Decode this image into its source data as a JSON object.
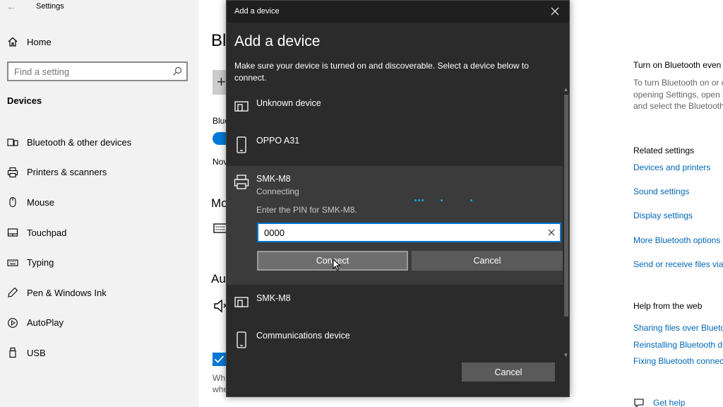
{
  "settings": {
    "app_title": "Settings",
    "home_label": "Home",
    "search_placeholder": "Find a setting",
    "section_title": "Devices",
    "nav": [
      {
        "label": "Bluetooth & other devices",
        "icon": "bluetooth-devices-icon"
      },
      {
        "label": "Printers & scanners",
        "icon": "printer-icon"
      },
      {
        "label": "Mouse",
        "icon": "mouse-icon"
      },
      {
        "label": "Touchpad",
        "icon": "touchpad-icon"
      },
      {
        "label": "Typing",
        "icon": "keyboard-icon"
      },
      {
        "label": "Pen & Windows Ink",
        "icon": "pen-icon"
      },
      {
        "label": "AutoPlay",
        "icon": "autoplay-icon"
      },
      {
        "label": "USB",
        "icon": "usb-icon"
      }
    ]
  },
  "page": {
    "heading_partial": "Bl",
    "bluetooth_label_partial": "Blue",
    "now_label_partial": "Nov",
    "mouse_section_partial": "Mo",
    "audio_section_partial": "Au",
    "wh_line1": "Wh",
    "wh_line2": "whe"
  },
  "right_pane": {
    "title": "Turn on Bluetooth even faster",
    "desc_lines": [
      "To turn Bluetooth on or off without",
      "opening Settings, open action center",
      "and select the Bluetooth icon."
    ],
    "related_title": "Related settings",
    "related_links": [
      "Devices and printers",
      "Sound settings",
      "Display settings",
      "More Bluetooth options",
      "Send or receive files via Bluetooth"
    ],
    "help_title": "Help from the web",
    "help_links": [
      "Sharing files over Bluetooth",
      "Reinstalling Bluetooth drivers",
      "Fixing Bluetooth connections"
    ],
    "get_help": "Get help"
  },
  "dialog": {
    "window_title": "Add a device",
    "heading": "Add a device",
    "description": "Make sure your device is turned on and discoverable. Select a device below to connect.",
    "devices": [
      {
        "name": "Unknown device",
        "icon": "display-device-icon"
      },
      {
        "name": "OPPO A31",
        "icon": "phone-icon"
      },
      {
        "name": "SMK-M8",
        "icon": "printer-icon",
        "status": "Connecting",
        "pin_prompt": "Enter the PIN for SMK-M8.",
        "pin_value": "0000",
        "connect_label": "Connect",
        "cancel_label": "Cancel"
      },
      {
        "name": "SMK-M8",
        "icon": "display-device-icon"
      },
      {
        "name": "Communications device",
        "icon": "phone-icon"
      }
    ],
    "cancel_label": "Cancel"
  }
}
